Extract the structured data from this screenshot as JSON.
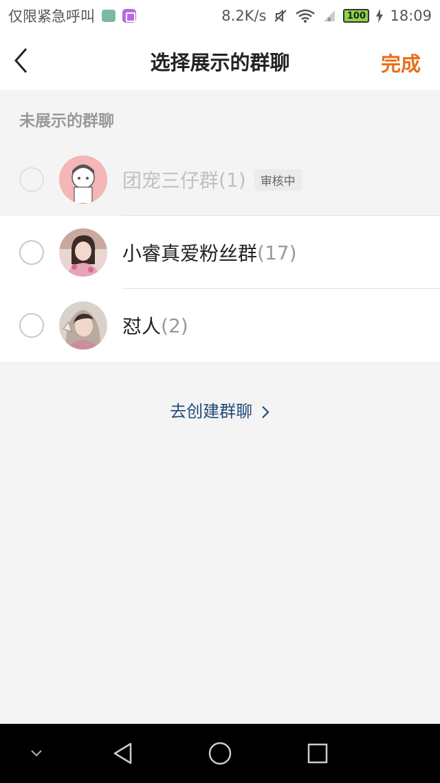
{
  "status_bar": {
    "carrier_text": "仅限紧急呼叫",
    "net_speed": "8.2K/s",
    "battery_level": "100",
    "time": "18:09"
  },
  "header": {
    "title": "选择展示的群聊",
    "done_label": "完成"
  },
  "section": {
    "label": "未展示的群聊"
  },
  "groups": [
    {
      "name": "团宠三仔群",
      "count": "(1)",
      "badge": "审核中",
      "disabled": true
    },
    {
      "name": "小睿真爱粉丝群",
      "count": "(17)",
      "disabled": false
    },
    {
      "name": "怼人",
      "count": "(2)",
      "disabled": false
    }
  ],
  "create_link": {
    "label": "去创建群聊"
  },
  "colors": {
    "accent": "#e8701a",
    "link": "#1f4b7a",
    "background": "#f4f4f4"
  },
  "icons": [
    "back-chevron-icon",
    "mute-icon",
    "wifi-icon",
    "signal-icon",
    "battery-icon",
    "charging-icon",
    "chevron-right-icon",
    "nav-back-icon",
    "nav-home-icon",
    "nav-recents-icon",
    "nav-collapse-icon"
  ]
}
